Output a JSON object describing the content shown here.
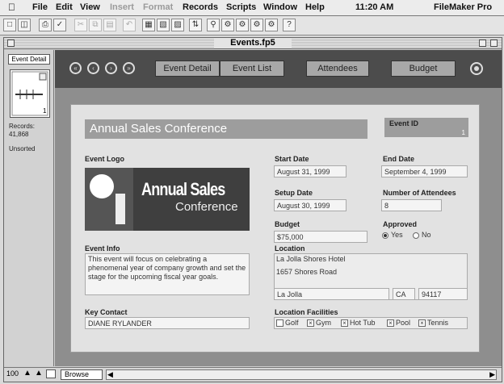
{
  "menubar": {
    "items": [
      {
        "label": "File",
        "enabled": true
      },
      {
        "label": "Edit",
        "enabled": true
      },
      {
        "label": "View",
        "enabled": true
      },
      {
        "label": "Insert",
        "enabled": false
      },
      {
        "label": "Format",
        "enabled": false
      },
      {
        "label": "Records",
        "enabled": true
      },
      {
        "label": "Scripts",
        "enabled": true
      },
      {
        "label": "Window",
        "enabled": true
      },
      {
        "label": "Help",
        "enabled": true
      }
    ],
    "clock": "11:20 AM",
    "app_name": "FileMaker Pro"
  },
  "window": {
    "title": "Events.fp5"
  },
  "status_area": {
    "layout_name": "Event Detail",
    "records_label": "Records:",
    "records_count": "41,868",
    "sort_state": "Unsorted",
    "book_page": "1"
  },
  "nav": {
    "tabs": [
      "Event Detail",
      "Event List",
      "Attendees",
      "Budget"
    ]
  },
  "form": {
    "event_title": "Annual Sales Conference",
    "event_id_label": "Event ID",
    "event_id_value": "1",
    "event_logo_label": "Event Logo",
    "logo_line1": "Annual Sales",
    "logo_line2": "Conference",
    "start_date_label": "Start Date",
    "start_date": "August 31, 1999",
    "end_date_label": "End Date",
    "end_date": "September 4, 1999",
    "setup_date_label": "Setup Date",
    "setup_date": "August 30, 1999",
    "attendees_label": "Number of Attendees",
    "attendees": "8",
    "budget_label": "Budget",
    "budget": "$75,000",
    "approved_label": "Approved",
    "approved_yes": "Yes",
    "approved_no": "No",
    "approved_value": "Yes",
    "event_info_label": "Event Info",
    "event_info": "This event will focus on celebrating a phenomenal year of company growth and set the stage for the upcoming fiscal year goals.",
    "location_label": "Location",
    "location_name": "La Jolla Shores Hotel",
    "location_street": "1657 Shores Road",
    "location_city": "La Jolla",
    "location_state": "CA",
    "location_zip": "94117",
    "key_contact_label": "Key Contact",
    "key_contact": "DIANE RYLANDER",
    "facilities_label": "Location Facilities",
    "facilities": [
      {
        "label": "Golf",
        "checked": false
      },
      {
        "label": "Gym",
        "checked": true
      },
      {
        "label": "Hot Tub",
        "checked": true
      },
      {
        "label": "Pool",
        "checked": true
      },
      {
        "label": "Tennis",
        "checked": true
      }
    ]
  },
  "bottom_bar": {
    "zoom": "100",
    "mode": "Browse"
  }
}
